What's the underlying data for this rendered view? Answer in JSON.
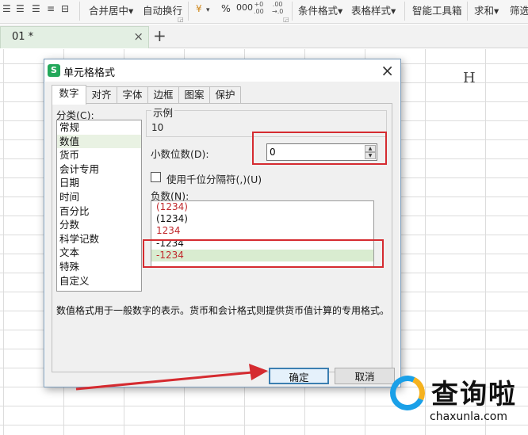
{
  "ribbon": {
    "merge_center": "合并居中",
    "wrap_text": "自动换行",
    "percent": "%",
    "thousands": "000",
    "inc_decimal_top": "+0",
    "inc_decimal_bottom": ".00",
    "dec_decimal_top": ".00",
    "dec_decimal_bottom": "→.0",
    "conditional_format": "条件格式",
    "table_style": "表格样式",
    "smart_toolbox": "智能工具箱",
    "sum": "求和",
    "filter": "筛选",
    "dropdown_glyph": "▾",
    "icons": [
      "align-center-icon",
      "align-right-icon",
      "justify-icon",
      "distribute-icon",
      "currency-icon"
    ]
  },
  "doc_tab": {
    "name": "01 *",
    "close": "×",
    "add": "+"
  },
  "grid": {
    "column_header_h": "H"
  },
  "dialog": {
    "title": "单元格格式",
    "logo": "S",
    "close": "×",
    "tabs": [
      {
        "label": "数字",
        "active": true
      },
      {
        "label": "对齐",
        "active": false
      },
      {
        "label": "字体",
        "active": false
      },
      {
        "label": "边框",
        "active": false
      },
      {
        "label": "图案",
        "active": false
      },
      {
        "label": "保护",
        "active": false
      }
    ],
    "category_label": "分类(C):",
    "categories": [
      {
        "label": "常规"
      },
      {
        "label": "数值"
      },
      {
        "label": "货币"
      },
      {
        "label": "会计专用"
      },
      {
        "label": "日期"
      },
      {
        "label": "时间"
      },
      {
        "label": "百分比"
      },
      {
        "label": "分数"
      },
      {
        "label": "科学记数"
      },
      {
        "label": "文本"
      },
      {
        "label": "特殊"
      },
      {
        "label": "自定义"
      }
    ],
    "selected_category_index": 1,
    "sample_label": "示例",
    "sample_value": "10",
    "decimal_label": "小数位数(D):",
    "decimal_value": "0",
    "thousands_checkbox_label": "使用千位分隔符(,)(U)",
    "thousands_checked": false,
    "negative_label": "负数(N):",
    "negative_options": [
      {
        "label": "(1234)",
        "color": "red"
      },
      {
        "label": "(1234)",
        "color": "black"
      },
      {
        "label": "1234",
        "color": "red"
      },
      {
        "label": "-1234",
        "color": "black"
      },
      {
        "label": "-1234",
        "color": "red"
      }
    ],
    "selected_negative_index": 4,
    "description": "数值格式用于一般数字的表示。货币和会计格式则提供货币值计算的专用格式。",
    "ok_button": "确定",
    "cancel_button": "取消"
  },
  "watermark": {
    "brand": "查询啦",
    "url": "chaxunla.com"
  },
  "colors": {
    "red_highlight": "#d52b30",
    "selection_green": "#d9ecd0",
    "tab_green": "#e3efe3",
    "primary_button_border": "#3c7fb1",
    "negative_red": "#c0282c"
  }
}
